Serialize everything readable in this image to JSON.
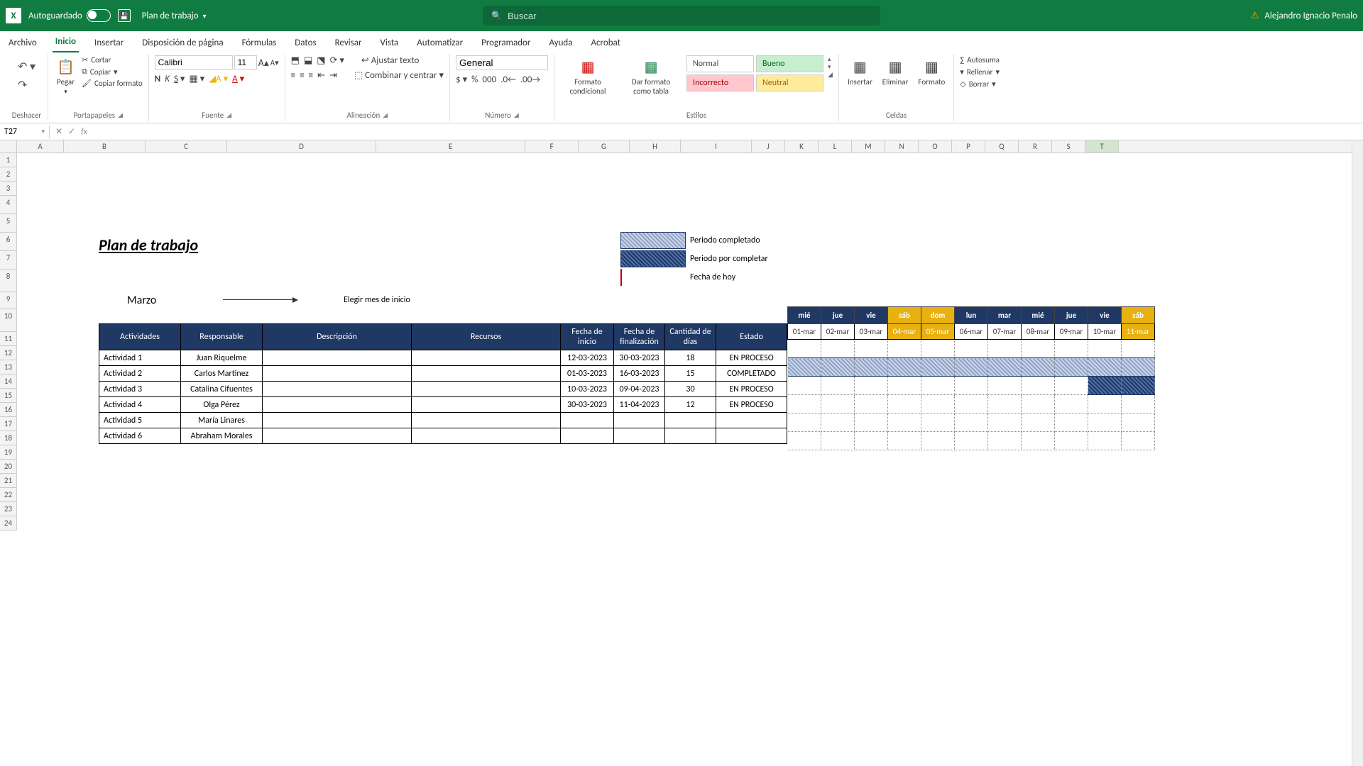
{
  "titleBar": {
    "autosave": "Autoguardado",
    "filename": "Plan de trabajo",
    "searchPlaceholder": "Buscar",
    "userName": "Alejandro Ignacio Penalo"
  },
  "tabs": [
    "Archivo",
    "Inicio",
    "Insertar",
    "Disposición de página",
    "Fórmulas",
    "Datos",
    "Revisar",
    "Vista",
    "Automatizar",
    "Programador",
    "Ayuda",
    "Acrobat"
  ],
  "activeTab": "Inicio",
  "ribbon": {
    "undo": "Deshacer",
    "clipboard": {
      "paste": "Pegar",
      "cut": "Cortar",
      "copy": "Copiar",
      "formatPainter": "Copiar formato",
      "label": "Portapapeles"
    },
    "font": {
      "name": "Calibri",
      "size": "11",
      "label": "Fuente"
    },
    "alignment": {
      "wrap": "Ajustar texto",
      "merge": "Combinar y centrar",
      "label": "Alineación"
    },
    "number": {
      "format": "General",
      "label": "Número"
    },
    "styles": {
      "conditional": "Formato condicional",
      "asTable": "Dar formato como tabla",
      "normal": "Normal",
      "good": "Bueno",
      "bad": "Incorrecto",
      "neutral": "Neutral",
      "label": "Estilos"
    },
    "cells": {
      "insert": "Insertar",
      "delete": "Eliminar",
      "format": "Formato",
      "label": "Celdas"
    },
    "editing": {
      "autosum": "Autosuma",
      "fill": "Rellenar",
      "clear": "Borrar"
    }
  },
  "nameBox": "T27",
  "formula": "",
  "columns": [
    "A",
    "B",
    "C",
    "D",
    "E",
    "F",
    "G",
    "H",
    "I",
    "J",
    "K",
    "L",
    "M",
    "N",
    "O",
    "P",
    "Q",
    "R",
    "S",
    "T"
  ],
  "selectedCol": "T",
  "rows": 24,
  "sheet": {
    "title": "Plan de trabajo",
    "legend": {
      "completed": "Periodo completado",
      "pending": "Periodo por completar",
      "today": "Fecha de hoy"
    },
    "month": "Marzo",
    "monthHint": "Elegir mes de inicio",
    "headers": {
      "act": "Actividades",
      "resp": "Responsable",
      "desc": "Descripción",
      "rec": "Recursos",
      "start": "Fecha de inicio",
      "end": "Fecha de finalización",
      "days": "Cantidad de días",
      "status": "Estado"
    },
    "rows": [
      {
        "act": "Actividad 1",
        "resp": "Juan Riquelme",
        "start": "12-03-2023",
        "end": "30-03-2023",
        "days": "18",
        "status": "EN PROCESO"
      },
      {
        "act": "Actividad 2",
        "resp": "Carlos Martinez",
        "start": "01-03-2023",
        "end": "16-03-2023",
        "days": "15",
        "status": "COMPLETADO"
      },
      {
        "act": "Actividad 3",
        "resp": "Catalina Cifuentes",
        "start": "10-03-2023",
        "end": "09-04-2023",
        "days": "30",
        "status": "EN PROCESO"
      },
      {
        "act": "Actividad 4",
        "resp": "Olga Pérez",
        "start": "30-03-2023",
        "end": "11-04-2023",
        "days": "12",
        "status": "EN PROCESO"
      },
      {
        "act": "Actividad 5",
        "resp": "María Linares",
        "start": "",
        "end": "",
        "days": "",
        "status": ""
      },
      {
        "act": "Actividad 6",
        "resp": "Abraham Morales",
        "start": "",
        "end": "",
        "days": "",
        "status": ""
      }
    ],
    "calendar": {
      "dayNames": [
        "mié",
        "jue",
        "vie",
        "sáb",
        "dom",
        "lun",
        "mar",
        "mié",
        "jue",
        "vie",
        "sáb"
      ],
      "weekendIdx": [
        3,
        4,
        10
      ],
      "dates": [
        "01-mar",
        "02-mar",
        "03-mar",
        "04-mar",
        "05-mar",
        "06-mar",
        "07-mar",
        "08-mar",
        "09-mar",
        "10-mar",
        "11-mar"
      ],
      "bars": [
        [],
        [
          0,
          1,
          2,
          3,
          4,
          5,
          6,
          7,
          8,
          9,
          10
        ],
        [
          9,
          10
        ],
        [],
        [],
        []
      ],
      "barType": [
        "",
        "compl",
        "done",
        "",
        "",
        ""
      ]
    }
  }
}
